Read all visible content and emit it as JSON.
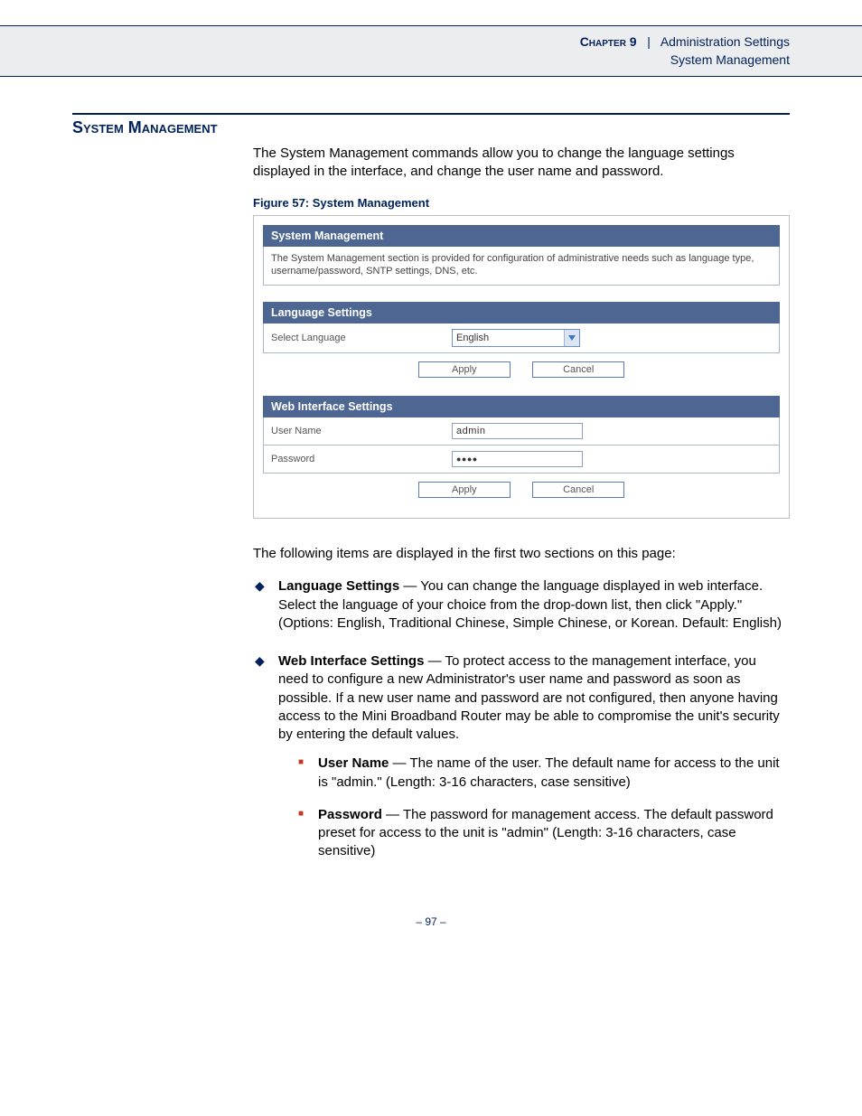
{
  "header": {
    "chapter_label": "Chapter 9",
    "separator": "|",
    "chapter_topic": "Administration Settings",
    "subtopic": "System Management"
  },
  "section": {
    "title": "System Management",
    "intro": "The System Management commands allow you to change the language settings displayed in the interface, and change the user name and password."
  },
  "figure": {
    "caption": "Figure 57:  System Management",
    "panel_title": "System Management",
    "panel_desc": "The System Management section is provided for configuration of administrative needs such as language type, username/password, SNTP settings, DNS, etc.",
    "lang": {
      "header": "Language Settings",
      "label": "Select Language",
      "value": "English",
      "apply": "Apply",
      "cancel": "Cancel"
    },
    "web": {
      "header": "Web Interface Settings",
      "user_label": "User Name",
      "user_value": "admin",
      "pass_label": "Password",
      "pass_value": "●●●●",
      "apply": "Apply",
      "cancel": "Cancel"
    }
  },
  "followup": "The following items are displayed in the first two sections on this page:",
  "bullets": {
    "lang_title": "Language Settings",
    "lang_text": " — You can change the language displayed in web interface. Select the language of your choice from the drop-down list, then click \"Apply.\" (Options: English, Traditional Chinese, Simple Chinese, or Korean. Default: English)",
    "web_title": "Web Interface Settings",
    "web_text": " — To protect access to the management interface, you need to configure a new Administrator's user name and password as soon as possible. If a new user name and password are not configured, then anyone having access to the Mini Broadband Router may be able to compromise the unit's security by entering the default values.",
    "user_title": "User Name",
    "user_text": " — The name of the user. The default name for access to the unit is \"admin.\" (Length: 3-16 characters, case sensitive)",
    "pass_title": "Password",
    "pass_text": " — The password for management access. The default password preset for access to the unit is \"admin\" (Length: 3-16 characters, case sensitive)"
  },
  "page_number": "–  97  –"
}
